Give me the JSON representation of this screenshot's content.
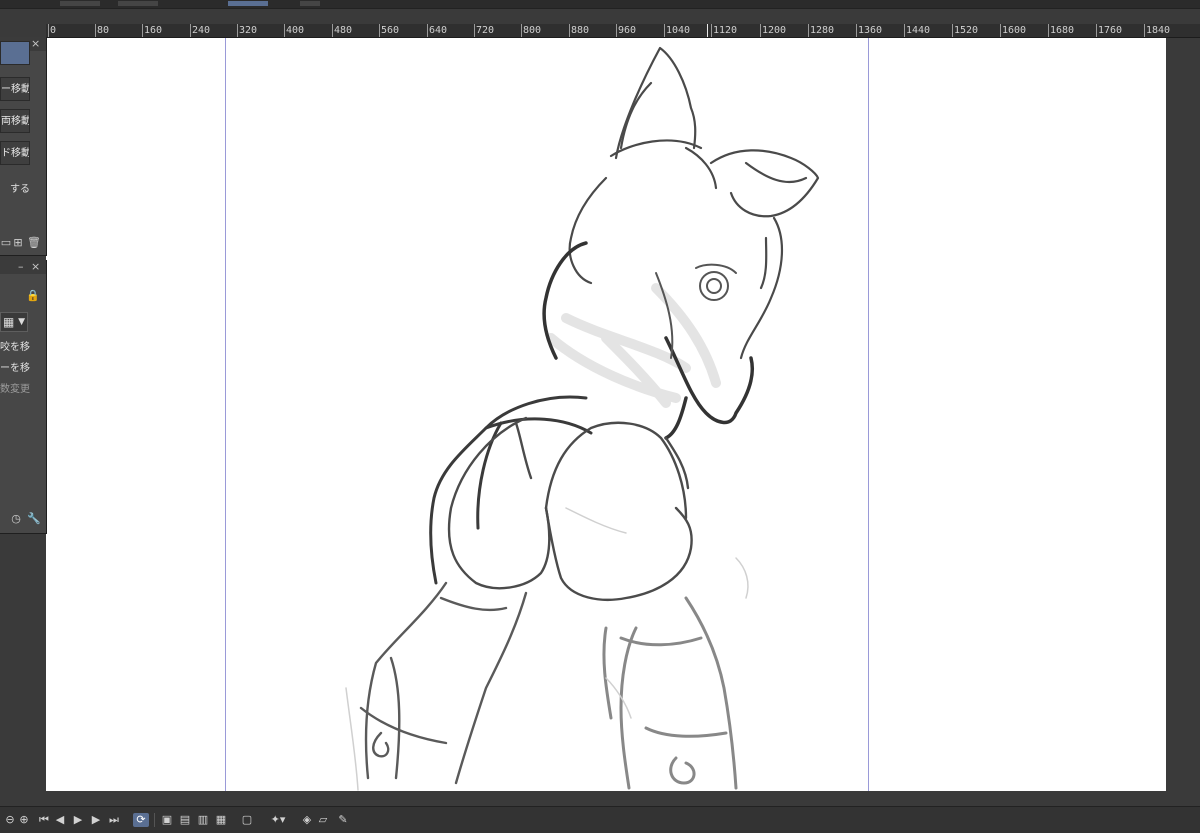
{
  "ruler": {
    "ticks": [
      "0",
      "80",
      "160",
      "240",
      "320",
      "400",
      "480",
      "560",
      "640",
      "720",
      "800",
      "880",
      "960",
      "1040",
      "1120",
      "1200",
      "1280",
      "1360",
      "1440",
      "1520",
      "1600",
      "1680",
      "1760",
      "1840"
    ]
  },
  "panel_top": {
    "options": [
      "ー移動",
      "両移動",
      "ド移動"
    ],
    "label": "する",
    "minimize": "–",
    "close": "×"
  },
  "panel_bottom": {
    "items": [
      "咬を移動",
      "ーを移動",
      "数変更"
    ],
    "minimize": "–",
    "close": "×"
  },
  "colors": {
    "accent": "#5a6f93",
    "canvas": "#ffffff",
    "guide": "#9a9ad8",
    "panel": "#474747"
  },
  "icons": {
    "top_panel_footer": [
      "new-folder-icon",
      "copy-layer-icon",
      "trash-icon"
    ],
    "bottom_panel_footer": [
      "clock-icon",
      "wrench-icon"
    ],
    "bottombar": [
      "zoom-out-icon",
      "zoom-in-icon",
      "first-frame-icon",
      "prev-frame-icon",
      "play-icon",
      "next-frame-icon",
      "last-frame-icon",
      "loop-icon",
      "new-animation-folder-icon",
      "add-cel-icon",
      "duplicate-cel-icon",
      "onion-skin-icon",
      "frame-icon",
      "light-table-icon",
      "move-icon",
      "brush-icon"
    ]
  }
}
